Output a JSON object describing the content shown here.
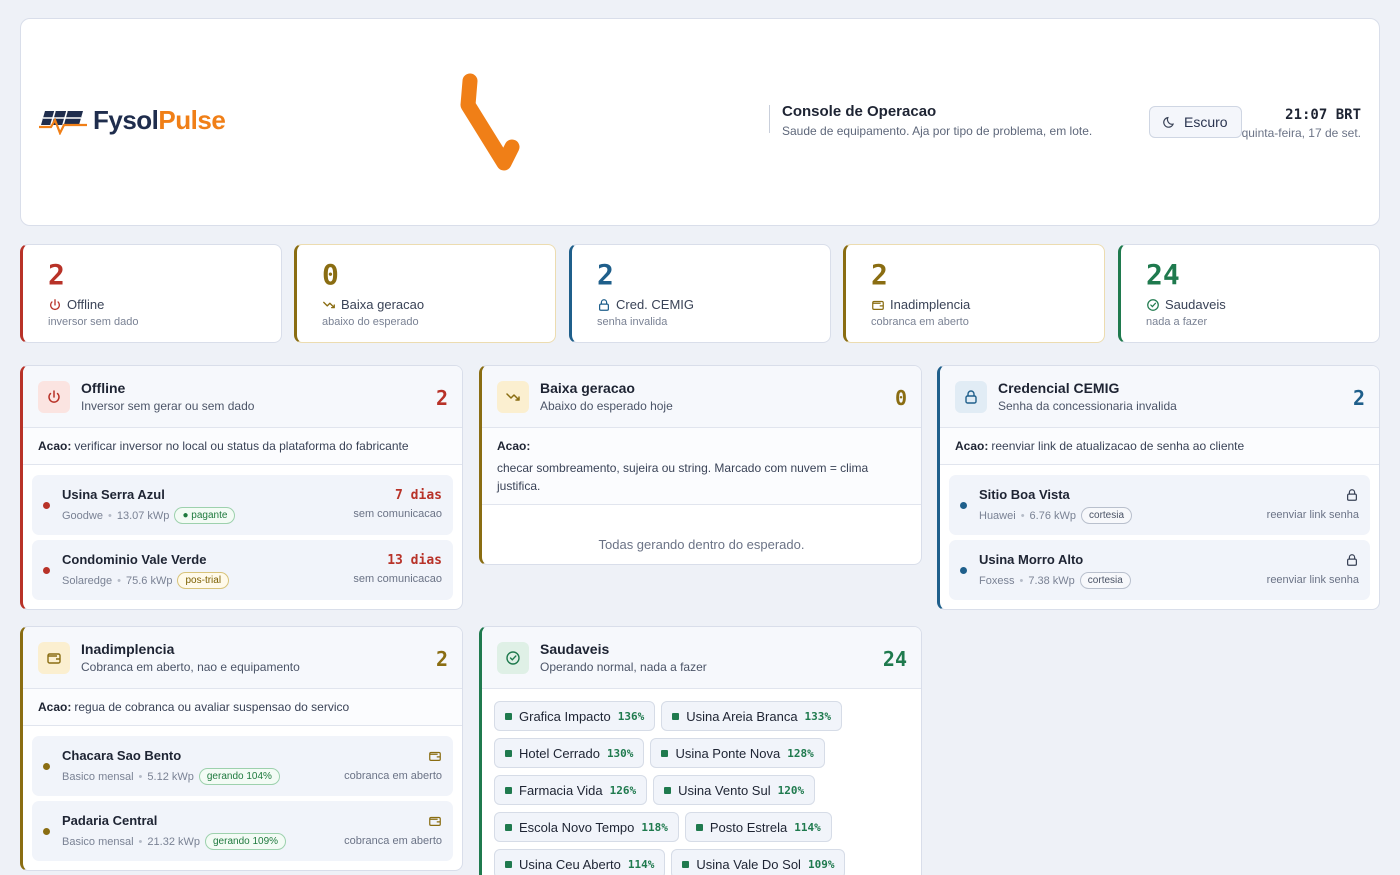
{
  "brand": {
    "name_a": "Fysol",
    "name_b": "Pulse"
  },
  "header": {
    "title": "Console de Operacao",
    "subtitle": "Saude de equipamento. Aja por tipo de problema, em lote.",
    "theme_label": "Escuro",
    "time": "21:07 BRT",
    "date": "quinta-feira, 17 de set."
  },
  "colors": {
    "red": "#b83228",
    "amber": "#8a6d12",
    "blue": "#1f5f8b",
    "green": "#1f7a4e",
    "orange": "#f07f17"
  },
  "stats": [
    {
      "value": "2",
      "label": "Offline",
      "sub": "inversor sem dado",
      "icon": "power-icon"
    },
    {
      "value": "0",
      "label": "Baixa geracao",
      "sub": "abaixo do esperado",
      "icon": "trending-down-icon"
    },
    {
      "value": "2",
      "label": "Cred. CEMIG",
      "sub": "senha invalida",
      "icon": "lock-icon"
    },
    {
      "value": "2",
      "label": "Inadimplencia",
      "sub": "cobranca em aberto",
      "icon": "wallet-icon"
    },
    {
      "value": "24",
      "label": "Saudaveis",
      "sub": "nada a fazer",
      "icon": "check-circle-icon"
    }
  ],
  "panels": {
    "offline": {
      "title": "Offline",
      "subtitle": "Inversor sem gerar ou sem dado",
      "count": "2",
      "acao_label": "Acao:",
      "acao": "verificar inversor no local ou status da plataforma do fabricante",
      "items": [
        {
          "name": "Usina Serra Azul",
          "brand": "Goodwe",
          "power": "13.07 kWp",
          "tag": "pagante",
          "days": "7 dias",
          "status": "sem comunicacao"
        },
        {
          "name": "Condominio Vale Verde",
          "brand": "Solaredge",
          "power": "75.6 kWp",
          "tag": "pos-trial",
          "days": "13 dias",
          "status": "sem comunicacao"
        }
      ]
    },
    "baixa": {
      "title": "Baixa geracao",
      "subtitle": "Abaixo do esperado hoje",
      "count": "0",
      "acao_label": "Acao:",
      "acao": "checar sombreamento, sujeira ou string. Marcado com nuvem = clima justifica.",
      "empty": "Todas gerando dentro do esperado."
    },
    "cemig": {
      "title": "Credencial CEMIG",
      "subtitle": "Senha da concessionaria invalida",
      "count": "2",
      "acao_label": "Acao:",
      "acao": "reenviar link de atualizacao de senha ao cliente",
      "items": [
        {
          "name": "Sitio Boa Vista",
          "brand": "Huawei",
          "power": "6.76 kWp",
          "tag": "cortesia",
          "status": "reenviar link senha"
        },
        {
          "name": "Usina Morro Alto",
          "brand": "Foxess",
          "power": "7.38 kWp",
          "tag": "cortesia",
          "status": "reenviar link senha"
        }
      ]
    },
    "inad": {
      "title": "Inadimplencia",
      "subtitle": "Cobranca em aberto, nao e equipamento",
      "count": "2",
      "acao_label": "Acao:",
      "acao": "regua de cobranca ou avaliar suspensao do servico",
      "items": [
        {
          "name": "Chacara Sao Bento",
          "brand": "Basico mensal",
          "power": "5.12 kWp",
          "tag": "gerando 104%",
          "status": "cobranca em aberto"
        },
        {
          "name": "Padaria Central",
          "brand": "Basico mensal",
          "power": "21.32 kWp",
          "tag": "gerando 109%",
          "status": "cobranca em aberto"
        }
      ]
    },
    "saude": {
      "title": "Saudaveis",
      "subtitle": "Operando normal, nada a fazer",
      "count": "24",
      "chips": [
        {
          "name": "Grafica Impacto",
          "pct": "136%"
        },
        {
          "name": "Usina Areia Branca",
          "pct": "133%"
        },
        {
          "name": "Hotel Cerrado",
          "pct": "130%"
        },
        {
          "name": "Usina Ponte Nova",
          "pct": "128%"
        },
        {
          "name": "Farmacia Vida",
          "pct": "126%"
        },
        {
          "name": "Usina Vento Sul",
          "pct": "120%"
        },
        {
          "name": "Escola Novo Tempo",
          "pct": "118%"
        },
        {
          "name": "Posto Estrela",
          "pct": "114%"
        },
        {
          "name": "Usina Ceu Aberto",
          "pct": "114%"
        },
        {
          "name": "Usina Vale Do Sol",
          "pct": "109%"
        }
      ]
    }
  }
}
